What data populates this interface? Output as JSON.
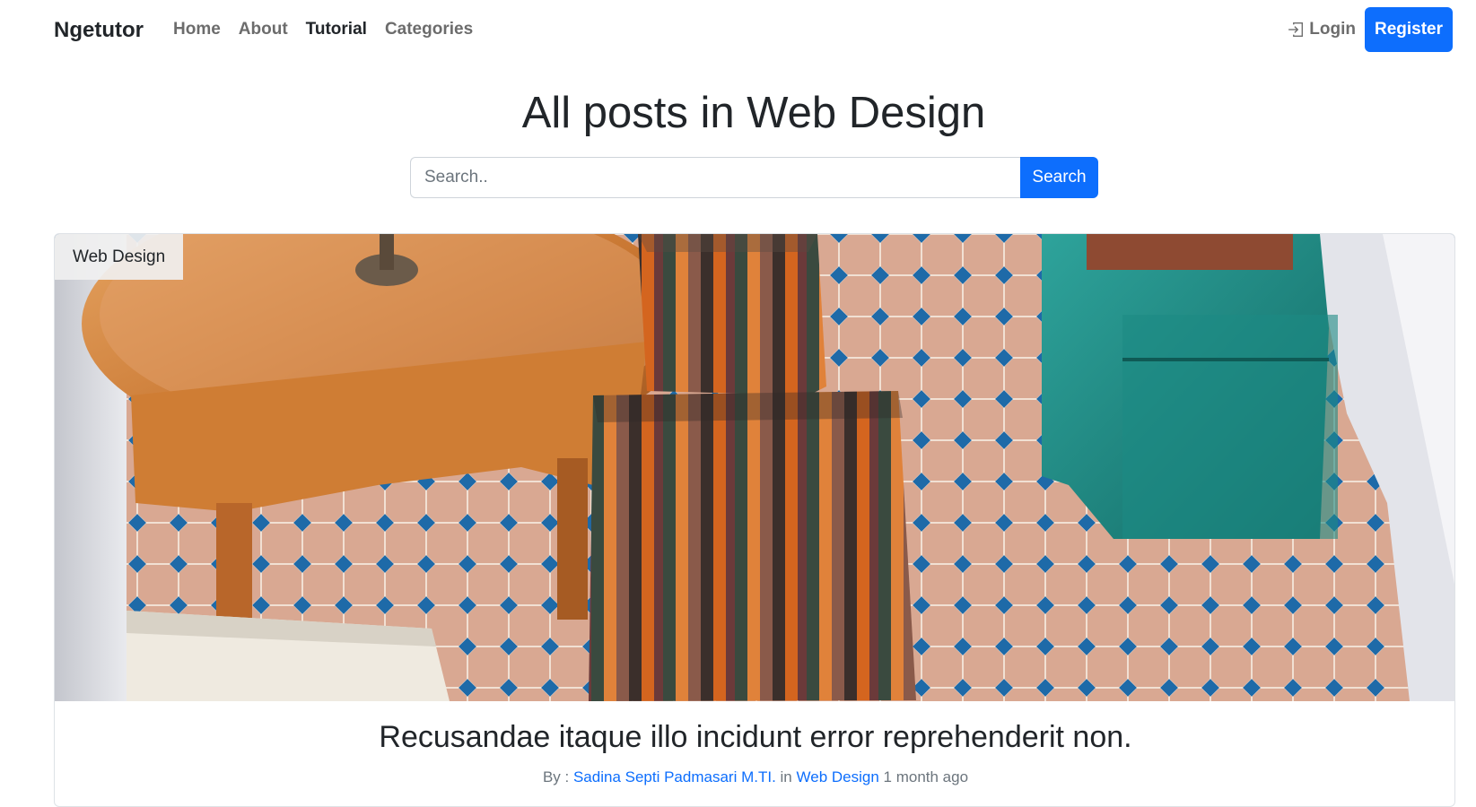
{
  "nav": {
    "brand": "Ngetutor",
    "links": [
      {
        "label": "Home"
      },
      {
        "label": "About"
      },
      {
        "label": "Tutorial"
      },
      {
        "label": "Categories"
      }
    ],
    "login_label": "Login",
    "register_label": "Register",
    "login_icon": "box-arrow-in-right-icon"
  },
  "page": {
    "title": "All posts in Web Design"
  },
  "search": {
    "placeholder": "Search..",
    "button_label": "Search"
  },
  "post": {
    "category_badge": "Web Design",
    "title": "Recusandae itaque illo incidunt error reprehenderit non.",
    "by_prefix": "By :",
    "author": "Sadina Septi Padmasari M.TI.",
    "in_word": "in",
    "category": "Web Design",
    "time": "1 month ago"
  },
  "colors": {
    "primary": "#0d6efd",
    "nav_text": "#6c6c6c",
    "text": "#212529"
  }
}
